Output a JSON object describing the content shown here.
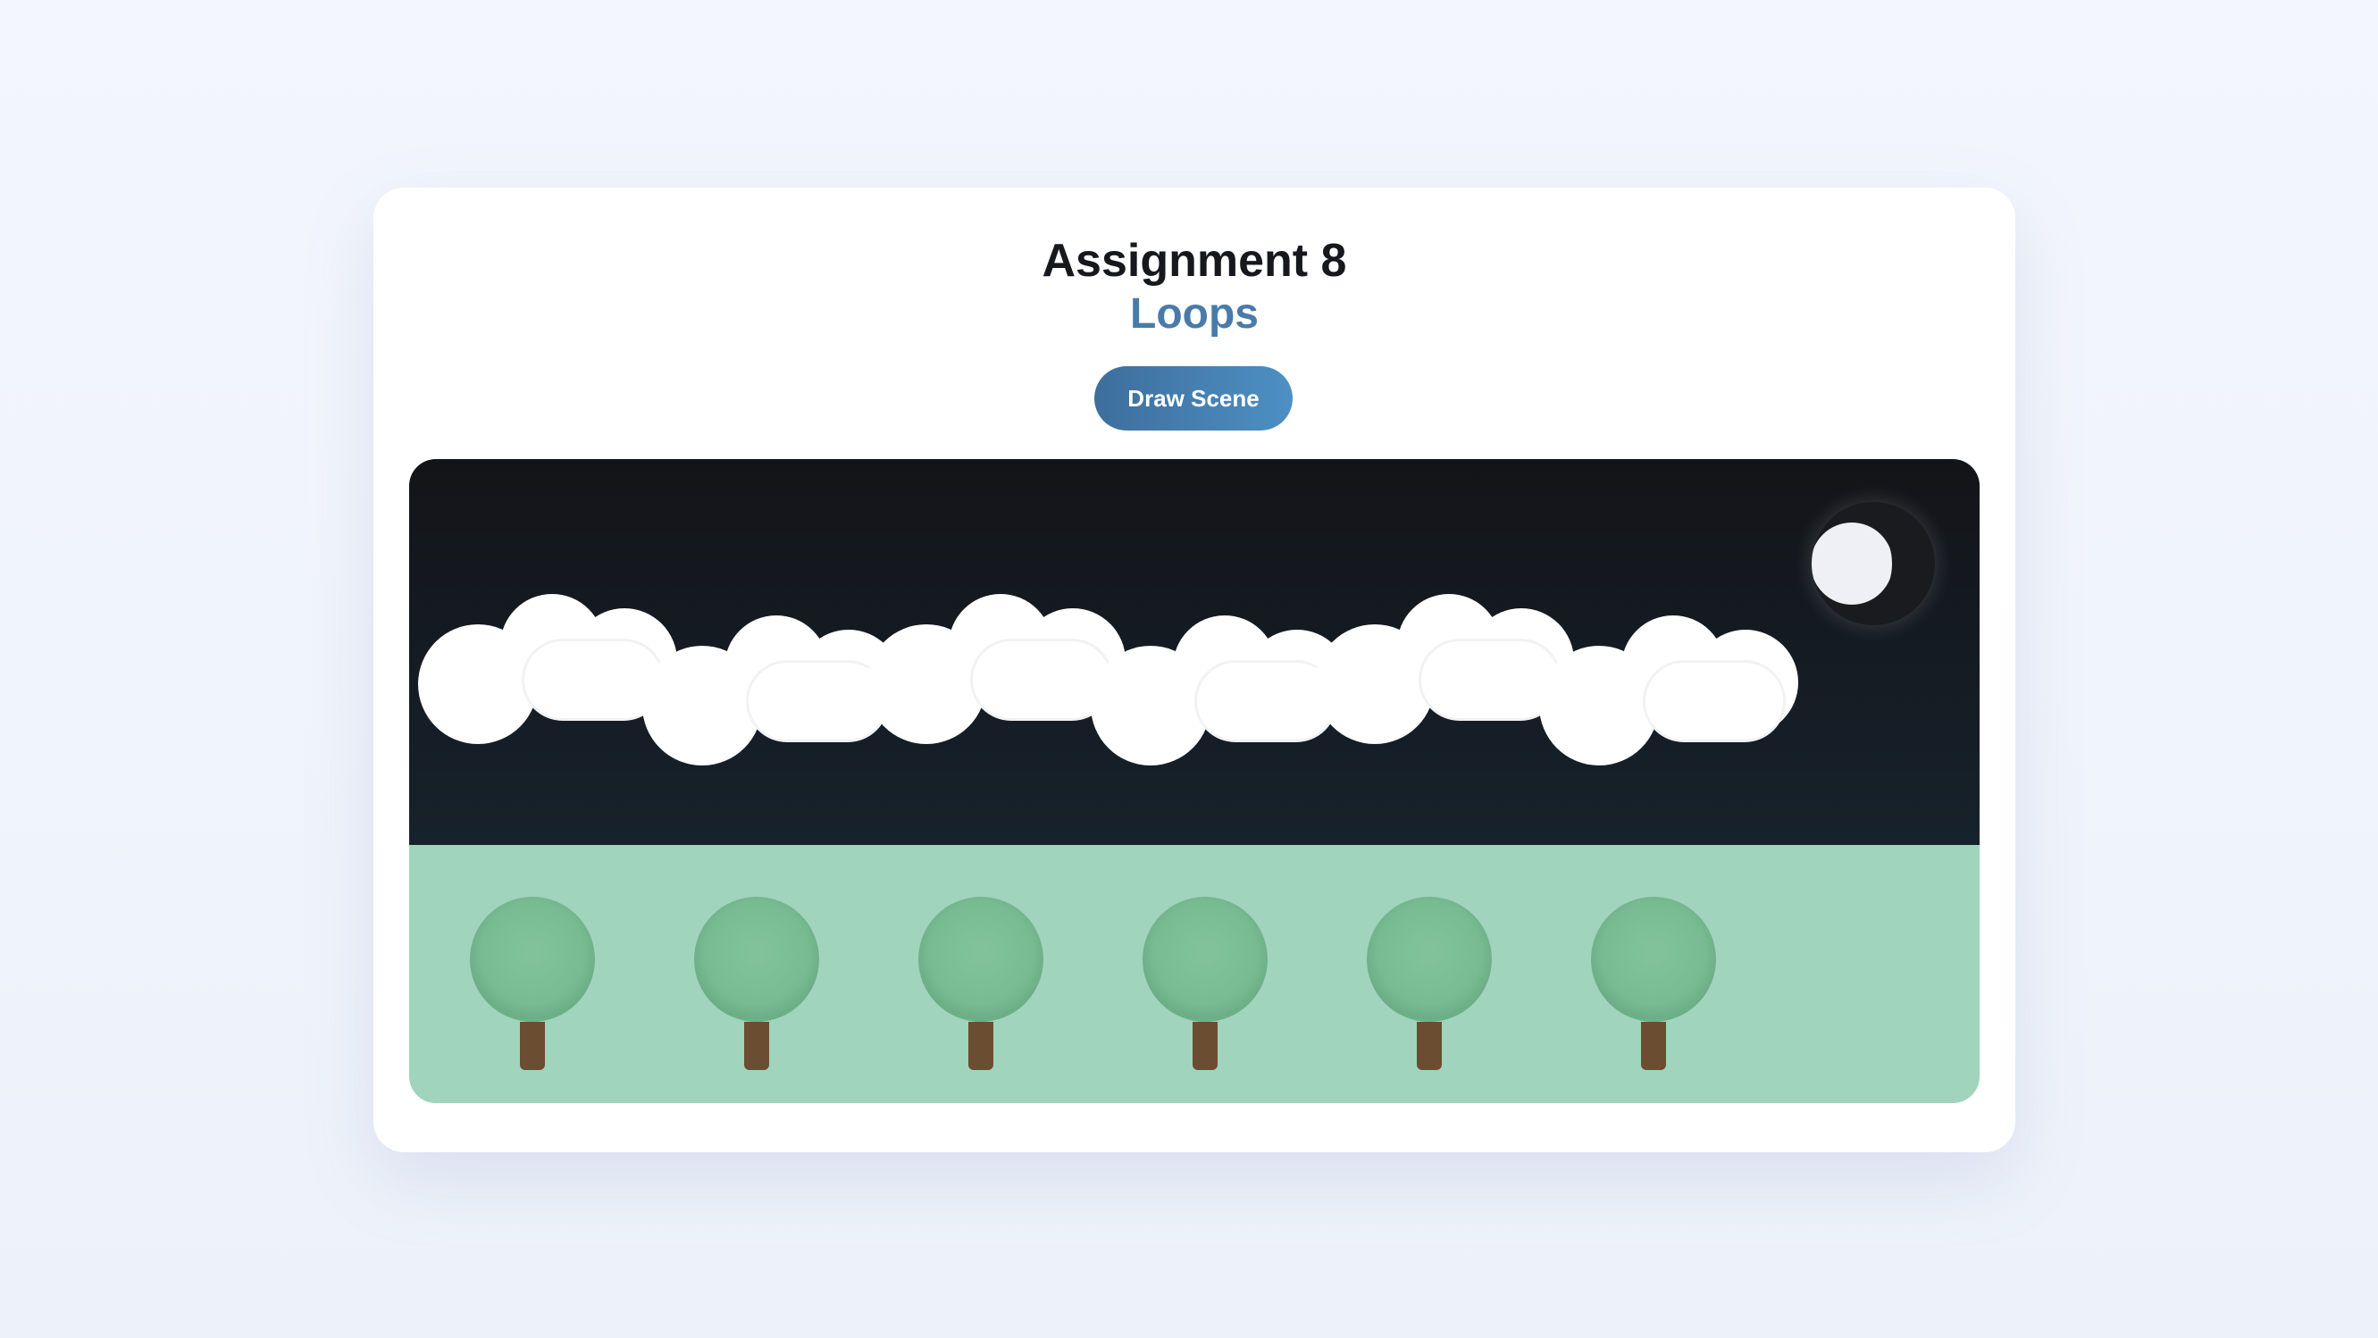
{
  "header": {
    "title": "Assignment 8",
    "subtitle": "Loops"
  },
  "toolbar": {
    "draw_label": "Draw Scene"
  },
  "scene": {
    "sky_color": "#131418",
    "ground_color": "#a0d4bc",
    "moon": {
      "phase": "crescent",
      "lit_color": "#eef0f5",
      "dark_color": "#1a1b1f"
    },
    "cloud_count": 6,
    "tree_count": 6,
    "tree_canopy_color": "#78bb92",
    "tree_trunk_color": "#6b4d32"
  }
}
